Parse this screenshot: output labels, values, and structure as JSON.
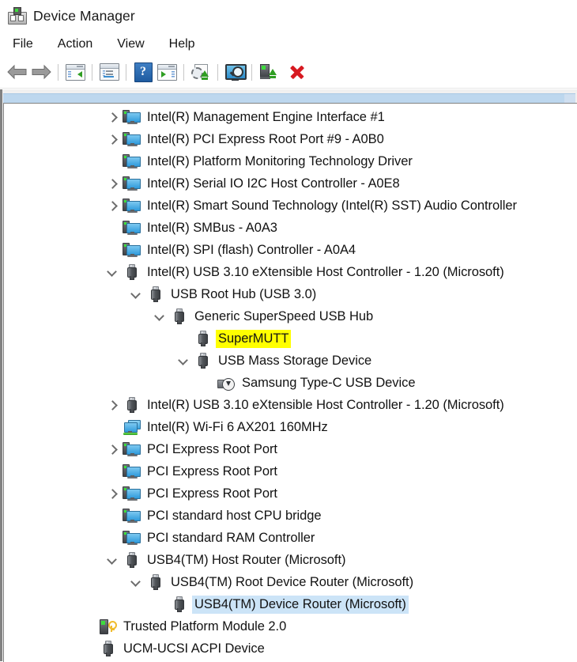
{
  "window": {
    "title": "Device Manager",
    "icon": "device-manager-icon"
  },
  "menu": {
    "items": [
      {
        "label": "File",
        "name": "menu-file"
      },
      {
        "label": "Action",
        "name": "menu-action"
      },
      {
        "label": "View",
        "name": "menu-view"
      },
      {
        "label": "Help",
        "name": "menu-help"
      }
    ]
  },
  "toolbar": {
    "buttons": [
      {
        "name": "back-button",
        "icon": "back-arrow-icon",
        "tooltip": "Back"
      },
      {
        "name": "forward-button",
        "icon": "forward-arrow-icon",
        "tooltip": "Forward"
      },
      {
        "name": "show-hide-console-tree-button",
        "icon": "console-tree-icon",
        "tooltip": "Show/Hide Console Tree"
      },
      {
        "name": "properties-button",
        "icon": "properties-icon",
        "tooltip": "Properties"
      },
      {
        "name": "help-button",
        "icon": "help-icon",
        "tooltip": "Help",
        "glyph": "?"
      },
      {
        "name": "update-driver-button",
        "icon": "update-driver-icon",
        "tooltip": "Update driver"
      },
      {
        "name": "scan-hardware-changes-button",
        "icon": "scan-for-hardware-changes-icon",
        "tooltip": "Scan for hardware changes"
      },
      {
        "name": "display-view-button",
        "icon": "monitor-magnifier-icon",
        "tooltip": "Display"
      },
      {
        "name": "enable-device-button",
        "icon": "enable-device-icon",
        "tooltip": "Enable device"
      },
      {
        "name": "uninstall-device-button",
        "icon": "red-x-icon",
        "tooltip": "Uninstall device"
      }
    ]
  },
  "tree": {
    "rows": [
      {
        "indent": 0,
        "chevron": "closed",
        "icon": "computer-icon",
        "label": "Intel(R) Management Engine Interface #1",
        "state": "normal"
      },
      {
        "indent": 0,
        "chevron": "closed",
        "icon": "computer-icon",
        "label": "Intel(R) PCI Express Root Port #9 - A0B0",
        "state": "normal"
      },
      {
        "indent": 0,
        "chevron": "none",
        "icon": "computer-icon",
        "label": "Intel(R) Platform Monitoring Technology Driver",
        "state": "normal"
      },
      {
        "indent": 0,
        "chevron": "closed",
        "icon": "computer-icon",
        "label": "Intel(R) Serial IO I2C Host Controller - A0E8",
        "state": "normal"
      },
      {
        "indent": 0,
        "chevron": "closed",
        "icon": "computer-icon",
        "label": "Intel(R) Smart Sound Technology (Intel(R) SST) Audio Controller",
        "state": "normal"
      },
      {
        "indent": 0,
        "chevron": "none",
        "icon": "computer-icon",
        "label": "Intel(R) SMBus - A0A3",
        "state": "normal"
      },
      {
        "indent": 0,
        "chevron": "none",
        "icon": "computer-icon",
        "label": "Intel(R) SPI (flash) Controller - A0A4",
        "state": "normal"
      },
      {
        "indent": 0,
        "chevron": "open",
        "icon": "usb-icon",
        "label": "Intel(R) USB 3.10 eXtensible Host Controller - 1.20 (Microsoft)",
        "state": "normal"
      },
      {
        "indent": 1,
        "chevron": "open",
        "icon": "usb-icon",
        "label": "USB Root Hub (USB 3.0)",
        "state": "normal"
      },
      {
        "indent": 2,
        "chevron": "open",
        "icon": "usb-icon",
        "label": "Generic SuperSpeed USB Hub",
        "state": "normal"
      },
      {
        "indent": 3,
        "chevron": "none",
        "icon": "usb-icon",
        "label": "SuperMUTT",
        "state": "highlighted"
      },
      {
        "indent": 3,
        "chevron": "open",
        "icon": "usb-icon",
        "label": "USB Mass Storage Device",
        "state": "normal"
      },
      {
        "indent": 4,
        "chevron": "none",
        "icon": "disk-drive-icon",
        "label": "Samsung Type-C USB Device",
        "state": "normal"
      },
      {
        "indent": 0,
        "chevron": "closed",
        "icon": "usb-icon",
        "label": "Intel(R) USB 3.10 eXtensible Host Controller - 1.20 (Microsoft)",
        "state": "normal"
      },
      {
        "indent": 0,
        "chevron": "none",
        "icon": "network-icon",
        "label": "Intel(R) Wi-Fi 6 AX201 160MHz",
        "state": "normal"
      },
      {
        "indent": 0,
        "chevron": "closed",
        "icon": "computer-icon",
        "label": "PCI Express Root Port",
        "state": "normal"
      },
      {
        "indent": 0,
        "chevron": "none",
        "icon": "computer-icon",
        "label": "PCI Express Root Port",
        "state": "normal"
      },
      {
        "indent": 0,
        "chevron": "closed",
        "icon": "computer-icon",
        "label": "PCI Express Root Port",
        "state": "normal"
      },
      {
        "indent": 0,
        "chevron": "none",
        "icon": "computer-icon",
        "label": "PCI standard host CPU bridge",
        "state": "normal"
      },
      {
        "indent": 0,
        "chevron": "none",
        "icon": "computer-icon",
        "label": "PCI standard RAM Controller",
        "state": "normal"
      },
      {
        "indent": 0,
        "chevron": "open",
        "icon": "usb-icon",
        "label": "USB4(TM) Host Router (Microsoft)",
        "state": "normal"
      },
      {
        "indent": 1,
        "chevron": "open",
        "icon": "usb-icon",
        "label": "USB4(TM) Root Device Router (Microsoft)",
        "state": "normal"
      },
      {
        "indent": 2,
        "chevron": "none",
        "icon": "usb-icon",
        "label": "USB4(TM) Device Router (Microsoft)",
        "state": "selected"
      },
      {
        "indent": -1,
        "chevron": "none",
        "icon": "security-device-icon",
        "label": "Trusted Platform Module 2.0",
        "state": "normal"
      },
      {
        "indent": -1,
        "chevron": "none",
        "icon": "usb-icon",
        "label": "UCM-UCSI ACPI Device",
        "state": "normal"
      }
    ]
  },
  "colors": {
    "highlight": "#ffff00",
    "selection": "#cce4f7",
    "scroll_strip": "#bdd7ee",
    "text": "#121212"
  }
}
